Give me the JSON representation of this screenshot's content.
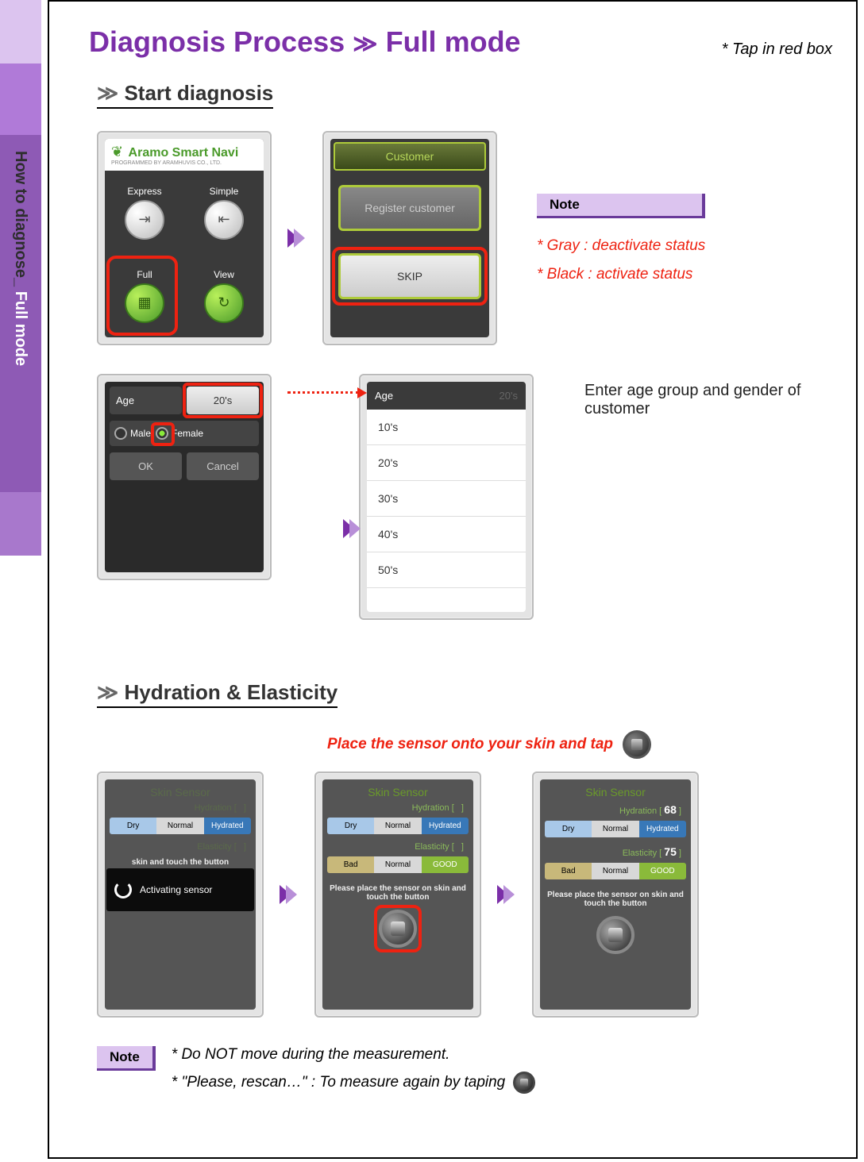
{
  "sidebar": {
    "prefix": "How to diagnose_",
    "accent": "Full mode"
  },
  "header": {
    "title_a": "Diagnosis Process",
    "title_b": "Full mode",
    "hint": "* Tap in red box"
  },
  "section1": {
    "heading": "Start diagnosis",
    "app": {
      "brand": "Aramo Smart Navi",
      "sub": "PROGRAMMED BY ARAMHUVIS CO., LTD.",
      "modes": {
        "express": "Express",
        "simple": "Simple",
        "full": "Full",
        "view": "View"
      }
    },
    "customer": {
      "tab": "Customer",
      "register": "Register customer",
      "skip": "SKIP"
    },
    "note_label": "Note",
    "note1": "* Gray : deactivate status",
    "note2": "* Black : activate status",
    "age_panel": {
      "age_label": "Age",
      "age_value": "20's",
      "male": "Male",
      "female": "Female",
      "ok": "OK",
      "cancel": "Cancel"
    },
    "age_list": {
      "header": "Age",
      "dim": "20's",
      "options": [
        "10's",
        "20's",
        "30's",
        "40's",
        "50's"
      ]
    },
    "age_instruction": "Enter age group and gender of customer"
  },
  "section2": {
    "heading": "Hydration & Elasticity",
    "place_hint": "Place the sensor onto your skin and tap",
    "skin_title": "Skin Sensor",
    "hydration_label": "Hydration",
    "elasticity_label": "Elasticity",
    "seg_h": [
      "Dry",
      "Normal",
      "Hydrated"
    ],
    "seg_e": [
      "Bad",
      "Normal",
      "GOOD"
    ],
    "activating": "Activating sensor",
    "msg": "Please place the sensor on skin and touch the button",
    "msg_dim": "skin and touch the button",
    "result": {
      "hydration": "68",
      "elasticity": "75"
    }
  },
  "footer": {
    "label": "Note",
    "line1": "* Do NOT move during the measurement.",
    "line2": "* \"Please, rescan…\" : To measure again by taping"
  }
}
